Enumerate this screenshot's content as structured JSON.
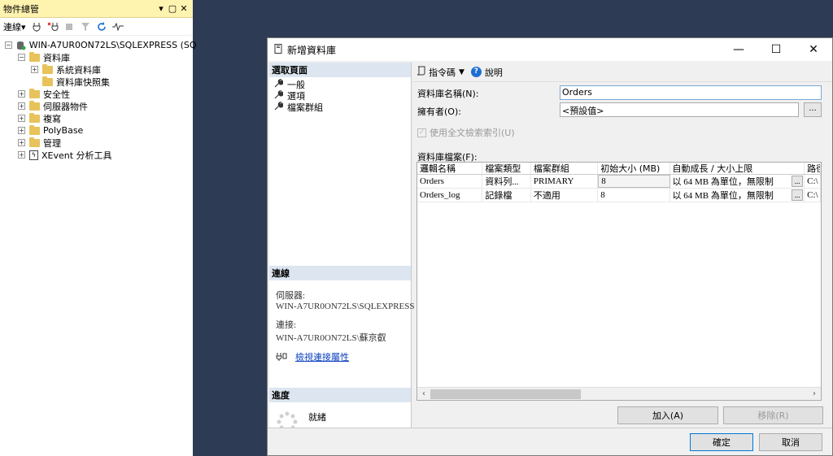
{
  "object_explorer": {
    "title": "物件總管",
    "title_controls": [
      "▾",
      "▢",
      "✕"
    ],
    "toolbar": {
      "connect_label": "連線▾"
    },
    "tree": [
      {
        "label": "WIN-A7UR0ON72LS\\SQLEXPRESS (SQ",
        "exp": "⊟",
        "level": 0,
        "icon": "server-icon"
      },
      {
        "label": "資料庫",
        "exp": "⊟",
        "level": 1,
        "icon": "folder-icon"
      },
      {
        "label": "系統資料庫",
        "exp": "⊞",
        "level": 2,
        "icon": "folder-icon"
      },
      {
        "label": "資料庫快照集",
        "exp": "",
        "level": 2,
        "icon": "folder-icon"
      },
      {
        "label": "安全性",
        "exp": "⊞",
        "level": 1,
        "icon": "folder-icon"
      },
      {
        "label": "伺服器物件",
        "exp": "⊞",
        "level": 1,
        "icon": "folder-icon"
      },
      {
        "label": "複寫",
        "exp": "⊞",
        "level": 1,
        "icon": "folder-icon"
      },
      {
        "label": "PolyBase",
        "exp": "⊞",
        "level": 1,
        "icon": "folder-icon"
      },
      {
        "label": "管理",
        "exp": "⊞",
        "level": 1,
        "icon": "folder-icon"
      },
      {
        "label": "XEvent 分析工具",
        "exp": "⊞",
        "level": 1,
        "icon": "xevent-icon"
      }
    ]
  },
  "dialog": {
    "title": "新增資料庫",
    "select_page": {
      "header": "選取頁面",
      "items": [
        "一般",
        "選項",
        "檔案群組"
      ]
    },
    "connection": {
      "header": "連線",
      "server_label": "伺服器:",
      "server_value": "WIN-A7UR0ON72LS\\SQLEXPRESS",
      "connection_label": "連接:",
      "connection_value": "WIN-A7UR0ON72LS\\蘇京叡",
      "view_properties_link": "檢視連接屬性"
    },
    "progress": {
      "header": "進度",
      "status": "就緒"
    },
    "toolbar": {
      "script_label": "指令碼",
      "help_label": "說明"
    },
    "form": {
      "db_name_label": "資料庫名稱(N):",
      "db_name_value": "Orders",
      "owner_label": "擁有者(O):",
      "owner_value": "<預設值>",
      "fulltext_label": "使用全文檢索索引(U)",
      "db_files_label": "資料庫檔案(F):"
    },
    "files_table": {
      "columns": [
        "邏輯名稱",
        "檔案類型",
        "檔案群組",
        "初始大小 (MB)",
        "自動成長 / 大小上限",
        "路徑"
      ],
      "rows": [
        [
          "Orders",
          "資料列...",
          "PRIMARY",
          "8",
          "以 64 MB 為單位，無限制",
          "C:\\"
        ],
        [
          "Orders_log",
          "記錄檔",
          "不適用",
          "8",
          "以 64 MB 為單位，無限制",
          "C:\\"
        ]
      ]
    },
    "add_button": "加入(A)",
    "remove_button": "移除(R)",
    "ok_button": "確定",
    "cancel_button": "取消"
  }
}
